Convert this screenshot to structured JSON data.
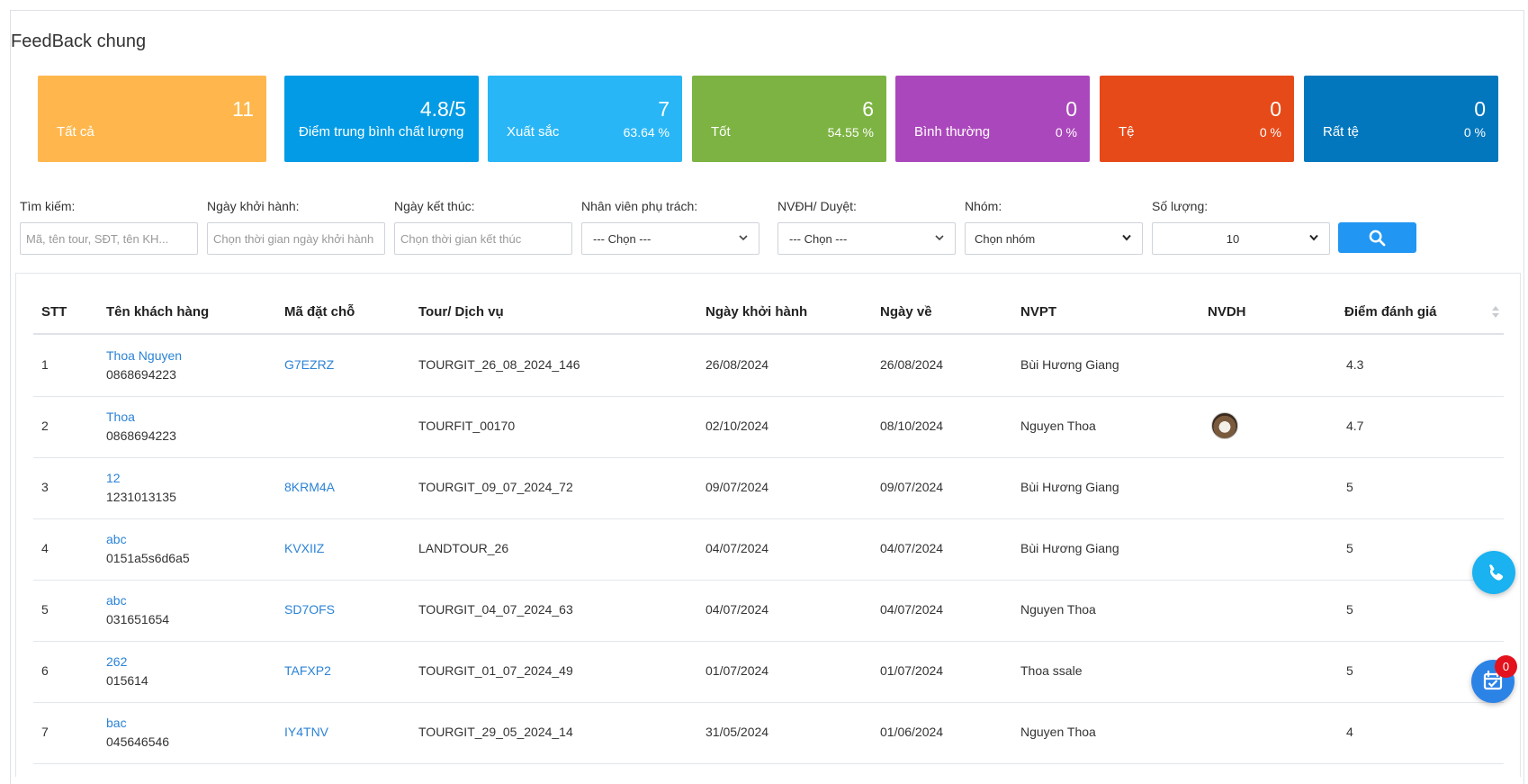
{
  "page_title": "FeedBack chung",
  "stats": [
    {
      "value": "11",
      "label": "Tất cả",
      "percent": "",
      "color": "#ffb74d"
    },
    {
      "value": "4.8/5",
      "label": "Điểm trung bình chất lượng",
      "percent": "",
      "color": "#039be5"
    },
    {
      "value": "7",
      "label": "Xuất sắc",
      "percent": "63.64 %",
      "color": "#29b6f6"
    },
    {
      "value": "6",
      "label": "Tốt",
      "percent": "54.55 %",
      "color": "#7cb342"
    },
    {
      "value": "0",
      "label": "Bình thường",
      "percent": "0 %",
      "color": "#ab47bc"
    },
    {
      "value": "0",
      "label": "Tệ",
      "percent": "0 %",
      "color": "#e64a19"
    },
    {
      "value": "0",
      "label": "Rất tệ",
      "percent": "0 %",
      "color": "#0277bd"
    }
  ],
  "filters": {
    "search": {
      "label": "Tìm kiếm:",
      "placeholder": "Mã, tên tour, SĐT, tên KH..."
    },
    "start_date": {
      "label": "Ngày khởi hành:",
      "placeholder": "Chọn thời gian ngày khởi hành"
    },
    "end_date": {
      "label": "Ngày kết thúc:",
      "placeholder": "Chọn thời gian kết thúc"
    },
    "staff": {
      "label": "Nhân viên phụ trách:",
      "value": "--- Chọn ---"
    },
    "approver": {
      "label": "NVĐH/ Duyệt:",
      "value": "--- Chọn ---"
    },
    "group": {
      "label": "Nhóm:",
      "value": "Chọn nhóm"
    },
    "quantity": {
      "label": "Số lượng:",
      "value": "10"
    },
    "search_button_icon": "search-icon"
  },
  "table": {
    "headers": [
      "STT",
      "Tên khách hàng",
      "Mã đặt chỗ",
      "Tour/ Dịch vụ",
      "Ngày khởi hành",
      "Ngày về",
      "NVPT",
      "NVDH",
      "Điểm đánh giá"
    ],
    "rows": [
      {
        "stt": "1",
        "name": "Thoa Nguyen",
        "phone": "0868694223",
        "code": "G7EZRZ",
        "tour": "TOURGIT_26_08_2024_146",
        "start": "26/08/2024",
        "end": "26/08/2024",
        "nvpt": "Bùi Hương Giang",
        "nvdh": "",
        "score": "4.3"
      },
      {
        "stt": "2",
        "name": "Thoa",
        "phone": "0868694223",
        "code": "",
        "tour": "TOURFIT_00170",
        "start": "02/10/2024",
        "end": "08/10/2024",
        "nvpt": "Nguyen Thoa",
        "nvdh": "avatar",
        "score": "4.7"
      },
      {
        "stt": "3",
        "name": "12",
        "phone": "1231013135",
        "code": "8KRM4A",
        "tour": "TOURGIT_09_07_2024_72",
        "start": "09/07/2024",
        "end": "09/07/2024",
        "nvpt": "Bùi Hương Giang",
        "nvdh": "",
        "score": "5"
      },
      {
        "stt": "4",
        "name": "abc",
        "phone": "0151a5s6d6a5",
        "code": "KVXIIZ",
        "tour": "LANDTOUR_26",
        "start": "04/07/2024",
        "end": "04/07/2024",
        "nvpt": "Bùi Hương Giang",
        "nvdh": "",
        "score": "5"
      },
      {
        "stt": "5",
        "name": "abc",
        "phone": "031651654",
        "code": "SD7OFS",
        "tour": "TOURGIT_04_07_2024_63",
        "start": "04/07/2024",
        "end": "04/07/2024",
        "nvpt": "Nguyen Thoa",
        "nvdh": "",
        "score": "5"
      },
      {
        "stt": "6",
        "name": "262",
        "phone": "015614",
        "code": "TAFXP2",
        "tour": "TOURGIT_01_07_2024_49",
        "start": "01/07/2024",
        "end": "01/07/2024",
        "nvpt": "Thoa ssale",
        "nvdh": "",
        "score": "5"
      },
      {
        "stt": "7",
        "name": "bac",
        "phone": "045646546",
        "code": "IY4TNV",
        "tour": "TOURGIT_29_05_2024_14",
        "start": "31/05/2024",
        "end": "01/06/2024",
        "nvpt": "Nguyen Thoa",
        "nvdh": "",
        "score": "4"
      }
    ]
  },
  "floating": {
    "phone_icon": "phone-icon",
    "calendar_icon": "calendar-check-icon",
    "calendar_badge": "0"
  }
}
